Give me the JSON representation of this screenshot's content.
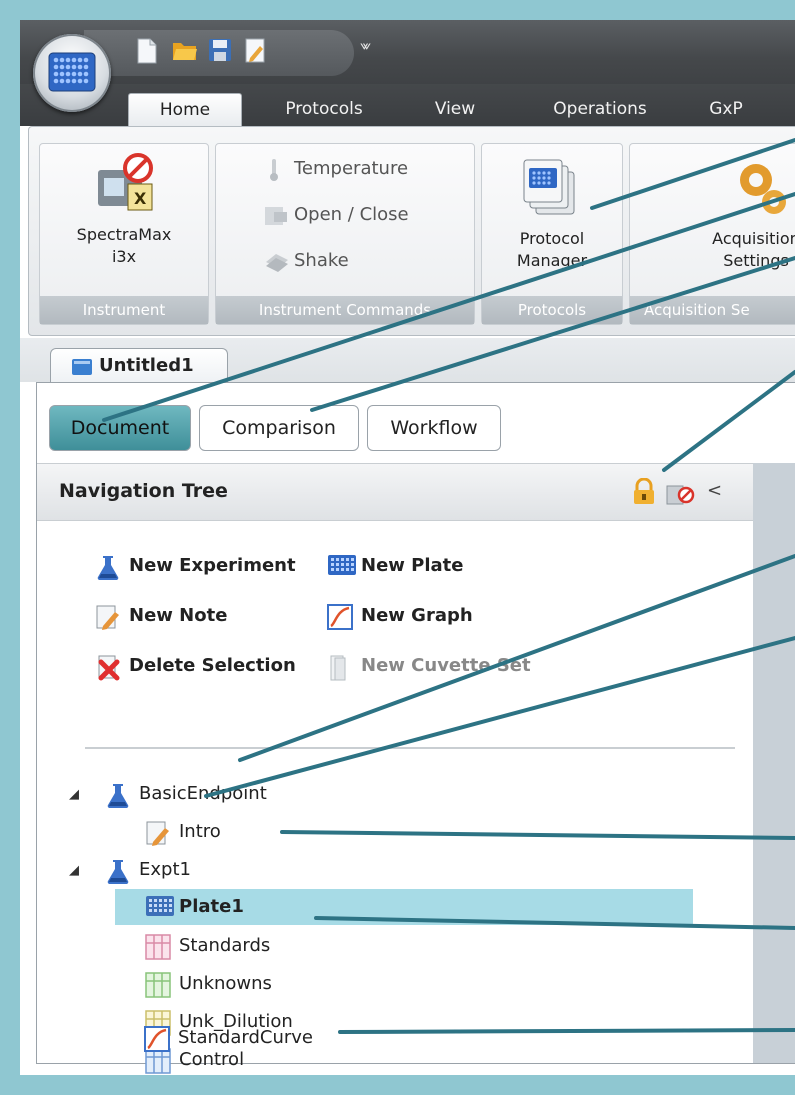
{
  "ribbon": {
    "tabs": [
      {
        "label": "Home",
        "active": true
      },
      {
        "label": "Protocols",
        "active": false
      },
      {
        "label": "View",
        "active": false
      },
      {
        "label": "Operations",
        "active": false
      },
      {
        "label": "GxP",
        "active": false
      }
    ],
    "qat_more": "⩖",
    "groups": {
      "instrument": {
        "label": "Instrument",
        "button_line1": "SpectraMax",
        "button_line2": "i3x"
      },
      "instrument_commands": {
        "label": "Instrument Commands",
        "temperature": "Temperature",
        "open_close": "Open / Close",
        "shake": "Shake"
      },
      "protocols": {
        "label": "Protocols",
        "button_line1": "Protocol",
        "button_line2": "Manager"
      },
      "acquisition": {
        "label": "Acquisition Se",
        "button_line1": "Acquisition",
        "button_line2": "Settings"
      }
    }
  },
  "document": {
    "tab_label": "Untitled1",
    "view_tabs": [
      {
        "label": "Document",
        "active": true
      },
      {
        "label": "Comparison",
        "active": false
      },
      {
        "label": "Workflow",
        "active": false
      }
    ]
  },
  "navigation": {
    "title": "Navigation Tree",
    "collapse_glyph": "<",
    "commands": {
      "new_experiment": "New Experiment",
      "new_plate": "New Plate",
      "new_note": "New Note",
      "new_graph": "New Graph",
      "delete_selection": "Delete Selection",
      "new_cuvette_set": "New Cuvette Set"
    },
    "tree": {
      "expander": "◢",
      "exp1": {
        "label": "BasicEndpoint",
        "children": {
          "intro": "Intro"
        }
      },
      "exp2": {
        "label": "Expt1",
        "children": {
          "plate1": "Plate1",
          "standards": "Standards",
          "unknowns": "Unknowns",
          "unk_dilution": "Unk_Dilution",
          "control": "Control",
          "standard_curve": "StandardCurve"
        }
      }
    }
  },
  "colors": {
    "callout": "#2d7384",
    "frame": "#8fc7d1",
    "selection": "#a7dbe6",
    "active_tab": "#4d9ea8"
  }
}
